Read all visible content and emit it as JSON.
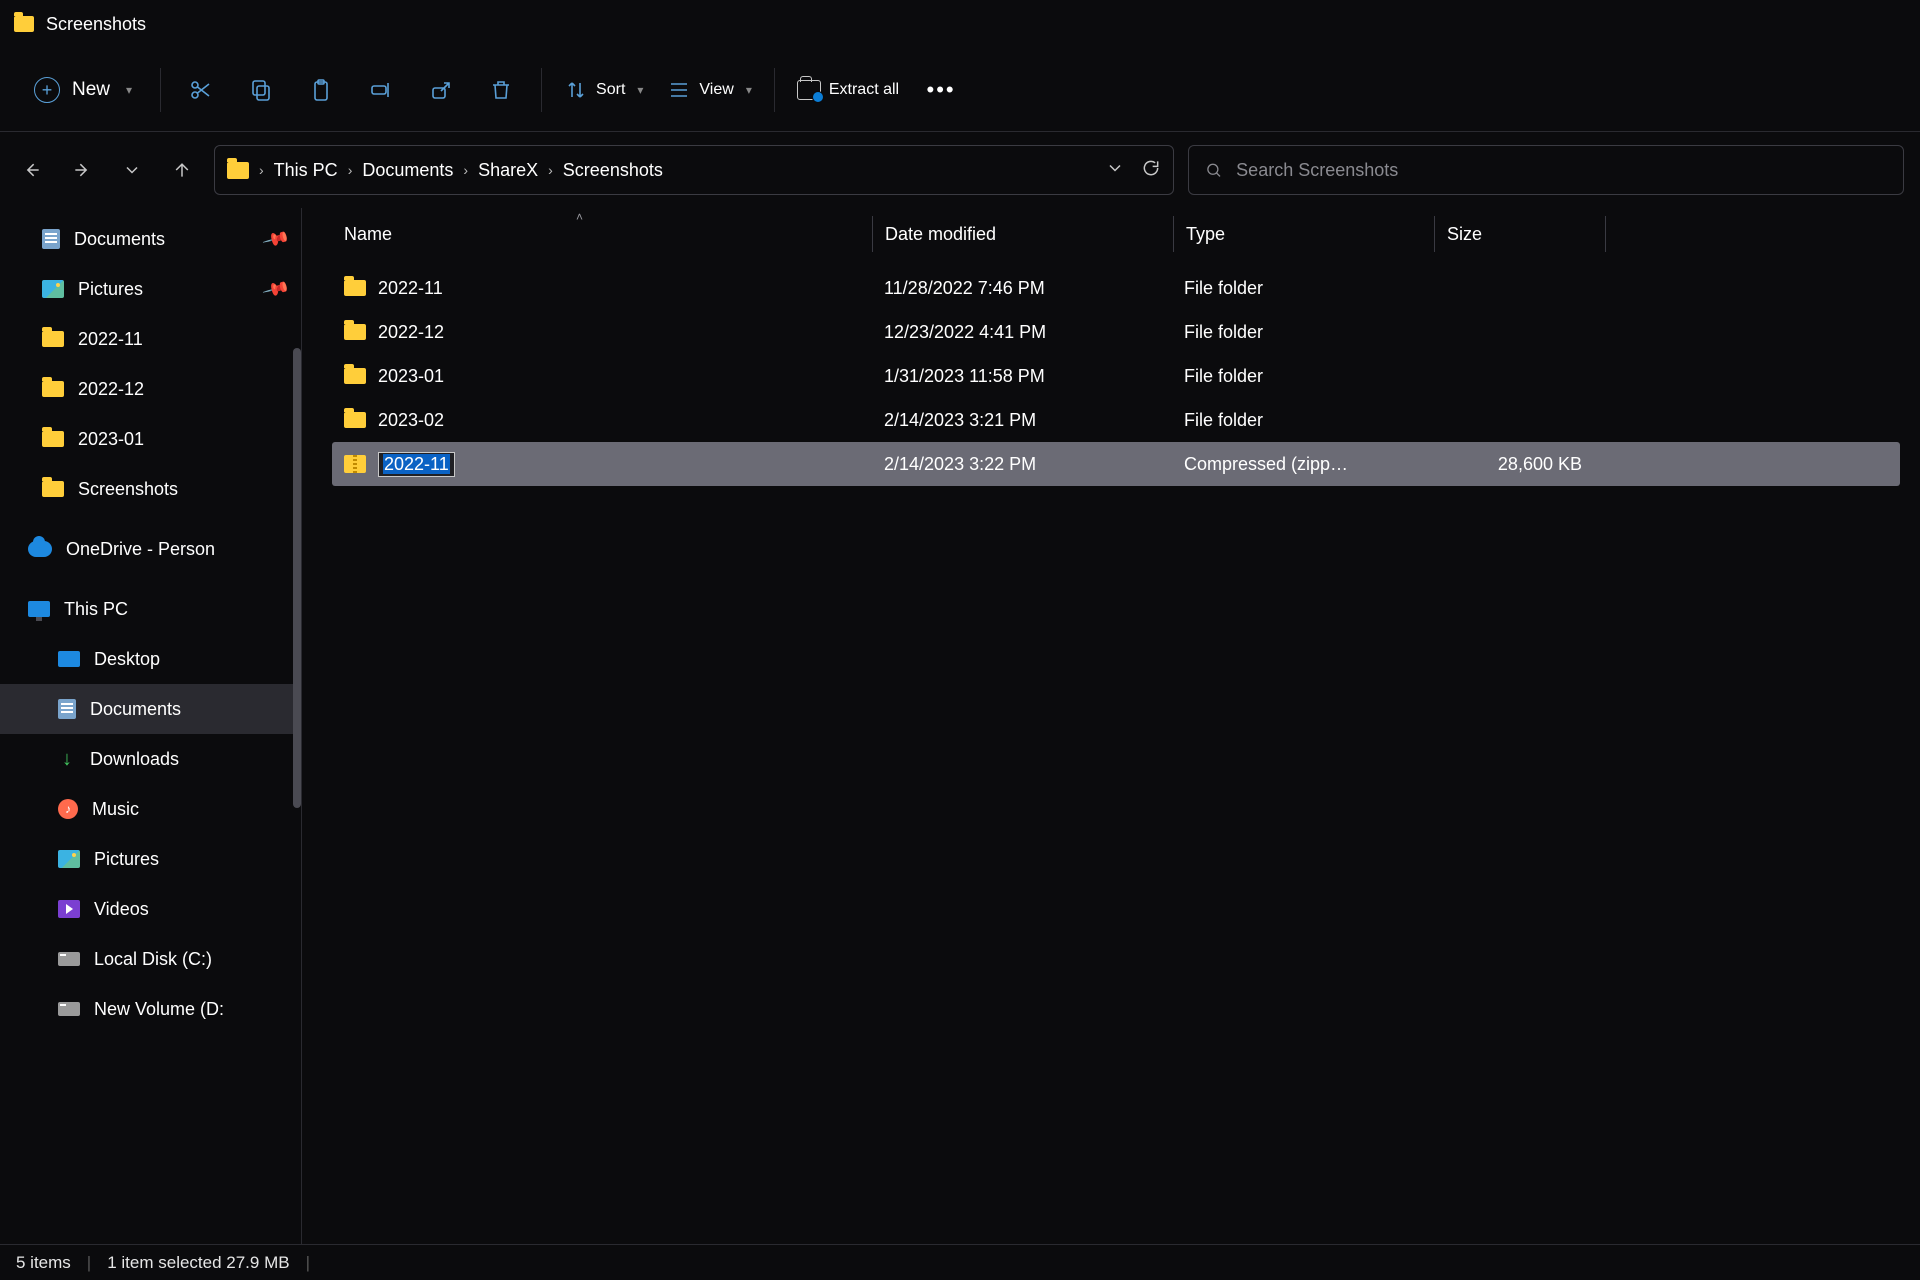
{
  "window_title": "Screenshots",
  "toolbar": {
    "new_label": "New",
    "sort_label": "Sort",
    "view_label": "View",
    "extract_label": "Extract all"
  },
  "breadcrumb": [
    "This PC",
    "Documents",
    "ShareX",
    "Screenshots"
  ],
  "search_placeholder": "Search Screenshots",
  "columns": {
    "name": "Name",
    "date": "Date modified",
    "type": "Type",
    "size": "Size"
  },
  "sidebar": {
    "quick": [
      {
        "label": "Documents",
        "icon": "doc",
        "pinned": true
      },
      {
        "label": "Pictures",
        "icon": "pic",
        "pinned": true
      },
      {
        "label": "2022-11",
        "icon": "folder"
      },
      {
        "label": "2022-12",
        "icon": "folder"
      },
      {
        "label": "2023-01",
        "icon": "folder"
      },
      {
        "label": "Screenshots",
        "icon": "folder"
      }
    ],
    "onedrive_label": "OneDrive - Person",
    "thispc_label": "This PC",
    "thispc": [
      {
        "label": "Desktop",
        "icon": "desktop"
      },
      {
        "label": "Documents",
        "icon": "doc",
        "active": true
      },
      {
        "label": "Downloads",
        "icon": "download"
      },
      {
        "label": "Music",
        "icon": "music"
      },
      {
        "label": "Pictures",
        "icon": "pic"
      },
      {
        "label": "Videos",
        "icon": "video"
      },
      {
        "label": "Local Disk (C:)",
        "icon": "disk"
      },
      {
        "label": "New Volume (D:",
        "icon": "disk"
      }
    ]
  },
  "files": [
    {
      "name": "2022-11",
      "date": "11/28/2022 7:46 PM",
      "type": "File folder",
      "size": "",
      "icon": "folder"
    },
    {
      "name": "2022-12",
      "date": "12/23/2022 4:41 PM",
      "type": "File folder",
      "size": "",
      "icon": "folder"
    },
    {
      "name": "2023-01",
      "date": "1/31/2023 11:58 PM",
      "type": "File folder",
      "size": "",
      "icon": "folder"
    },
    {
      "name": "2023-02",
      "date": "2/14/2023 3:21 PM",
      "type": "File folder",
      "size": "",
      "icon": "folder"
    },
    {
      "name": "2022-11",
      "date": "2/14/2023 3:22 PM",
      "type": "Compressed (zipp…",
      "size": "28,600 KB",
      "icon": "zip",
      "selected": true,
      "renaming": true
    }
  ],
  "status": {
    "count": "5 items",
    "selection": "1 item selected  27.9 MB"
  }
}
